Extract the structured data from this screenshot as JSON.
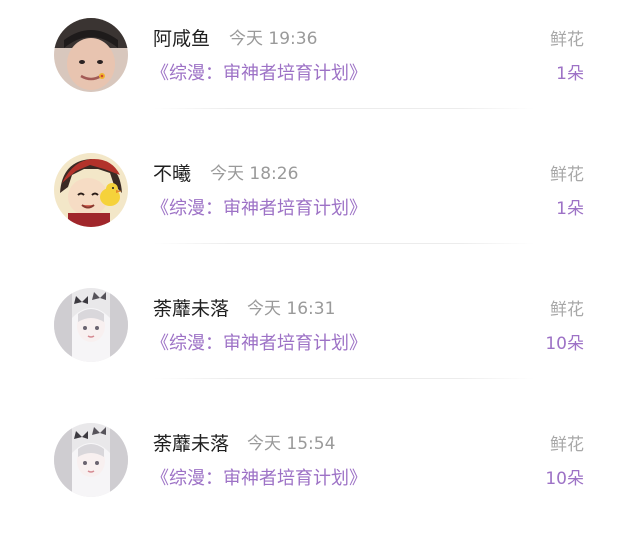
{
  "items": [
    {
      "name": "阿咸鱼",
      "time": "今天 19:36",
      "work": "《综漫：审神者培育计划》",
      "gift_label": "鲜花",
      "amount": "1朵",
      "avatar": "boy-photo-avatar"
    },
    {
      "name": "不曦",
      "time": "今天 18:26",
      "work": "《综漫：审神者培育计划》",
      "gift_label": "鲜花",
      "amount": "1朵",
      "avatar": "anime-boy-duck-avatar"
    },
    {
      "name": "荼蘼未落",
      "time": "今天 16:31",
      "work": "《综漫：审神者培育计划》",
      "gift_label": "鲜花",
      "amount": "10朵",
      "avatar": "butterfly-girl-avatar"
    },
    {
      "name": "荼蘼未落",
      "time": "今天 15:54",
      "work": "《综漫：审神者培育计划》",
      "gift_label": "鲜花",
      "amount": "10朵",
      "avatar": "butterfly-girl-avatar"
    }
  ],
  "colors": {
    "accent": "#9d72c6",
    "name": "#1f1f1f",
    "muted": "#9a9a9a"
  }
}
